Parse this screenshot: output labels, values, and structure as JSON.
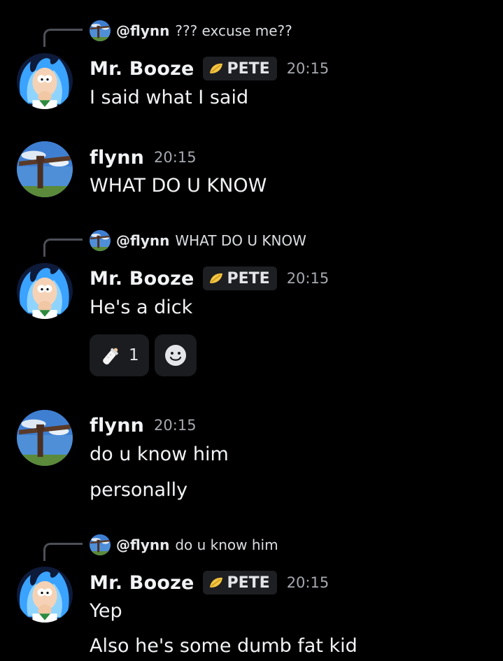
{
  "colors": {
    "background": "#000000",
    "text": "#f2f3f5",
    "muted": "#a5a8ae",
    "tag_bg": "#1e1f22",
    "reaction_bg": "#1b1c1f",
    "spine": "#4e5058"
  },
  "messages": [
    {
      "reply": {
        "mention": "@flynn",
        "text": "??? excuse me??"
      },
      "author": "Mr. Booze",
      "tag": "PETE",
      "tag_icon": "leaf-badge-icon",
      "time": "20:15",
      "lines": [
        "I said what I said"
      ]
    },
    {
      "author": "flynn",
      "time": "20:15",
      "lines": [
        "WHAT DO U KNOW"
      ]
    },
    {
      "reply": {
        "mention": "@flynn",
        "text": "WHAT DO U KNOW"
      },
      "author": "Mr. Booze",
      "tag": "PETE",
      "tag_icon": "leaf-badge-icon",
      "time": "20:15",
      "lines": [
        "He's a dick"
      ],
      "reactions": [
        {
          "icon": "baby-bottle-icon",
          "count": "1"
        },
        {
          "icon": "add-reaction-smiley-icon"
        }
      ]
    },
    {
      "author": "flynn",
      "time": "20:15",
      "lines": [
        "do u know him",
        "personally"
      ]
    },
    {
      "reply": {
        "mention": "@flynn",
        "text": "do u know him"
      },
      "author": "Mr. Booze",
      "tag": "PETE",
      "tag_icon": "leaf-badge-icon",
      "time": "20:15",
      "lines": [
        "Yep",
        "Also he's some dumb fat kid"
      ]
    }
  ]
}
